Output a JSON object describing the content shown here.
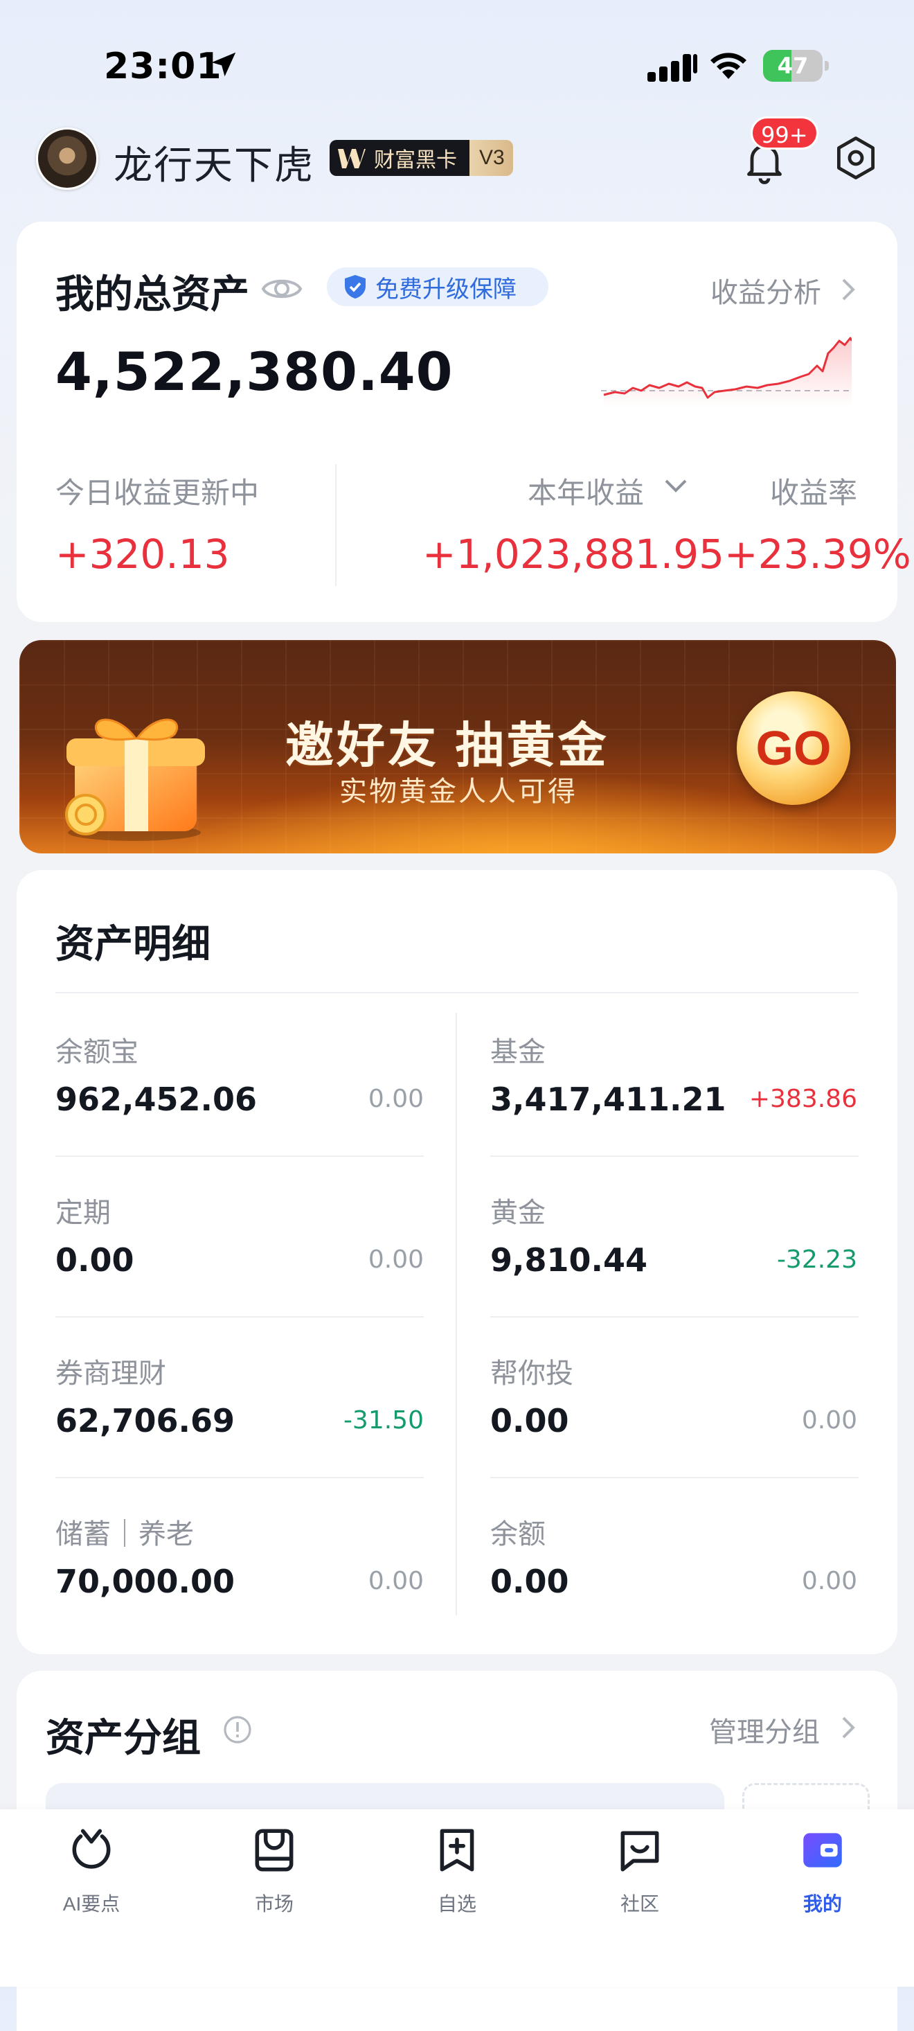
{
  "status_bar": {
    "time": "23:01",
    "battery": "47"
  },
  "header": {
    "username": "龙行天下虎",
    "vip_name": "财富黑卡",
    "vip_level": "V3",
    "notifications": "99+"
  },
  "total": {
    "title": "我的总资产",
    "protection": "免费升级保障",
    "analysis": "收益分析",
    "value": "4,522,380.40",
    "today_label": "今日收益更新中",
    "today_value": "+320.13",
    "year_label": "本年收益",
    "rate_label": "收益率",
    "year_value": "+1,023,881.95",
    "rate_value": "+23.39%"
  },
  "banner": {
    "title": "邀好友 抽黄金",
    "subtitle": "实物黄金人人可得",
    "button": "GO"
  },
  "detail": {
    "title": "资产明细",
    "items": [
      {
        "label": "余额宝",
        "value": "962,452.06",
        "change": "0.00"
      },
      {
        "label": "基金",
        "value": "3,417,411.21",
        "change": "+383.86"
      },
      {
        "label": "定期",
        "value": "0.00",
        "change": "0.00"
      },
      {
        "label": "黄金",
        "value": "9,810.44",
        "change": "-32.23"
      },
      {
        "label": "券商理财",
        "value": "62,706.69",
        "change": "-31.50"
      },
      {
        "label": "帮你投",
        "value": "0.00",
        "change": "0.00"
      },
      {
        "label": "储蓄｜养老",
        "value": "70,000.00",
        "change": "0.00"
      },
      {
        "label": "余额",
        "value": "0.00",
        "change": "0.00"
      }
    ]
  },
  "group": {
    "title": "资产分组",
    "manage": "管理分组"
  },
  "tabs": [
    {
      "label": "AI要点",
      "icon": "ai-icon"
    },
    {
      "label": "市场",
      "icon": "market-icon"
    },
    {
      "label": "自选",
      "icon": "watchlist-icon"
    },
    {
      "label": "社区",
      "icon": "community-icon"
    },
    {
      "label": "我的",
      "icon": "wallet-icon"
    }
  ],
  "colors": {
    "up": "#e8313c",
    "down": "#139a6e",
    "accent": "#2f5bea"
  }
}
